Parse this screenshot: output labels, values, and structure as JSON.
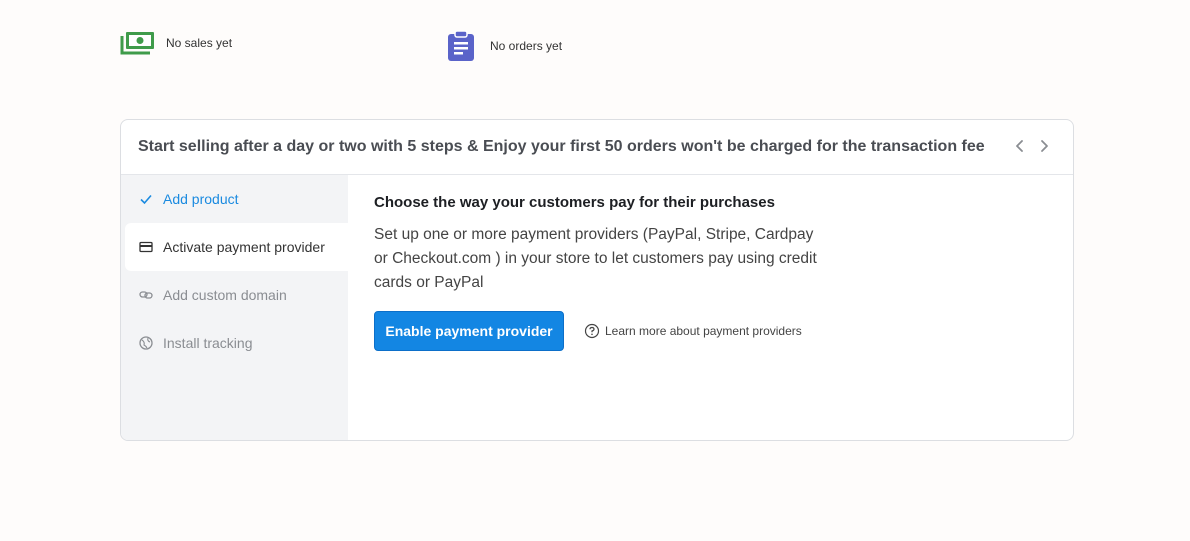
{
  "stats": {
    "sales_label": "No sales yet",
    "orders_label": "No orders yet"
  },
  "banner": {
    "title": "Start selling after a day or two with 5 steps & Enjoy your first 50 orders won't be charged for the transaction fee"
  },
  "steps": [
    {
      "label": "Add product",
      "icon": "check-icon",
      "state": "done"
    },
    {
      "label": "Activate payment provider",
      "icon": "credit-card-icon",
      "state": "active"
    },
    {
      "label": "Add custom domain",
      "icon": "link-icon",
      "state": "pending"
    },
    {
      "label": "Install tracking",
      "icon": "globe-icon",
      "state": "pending"
    }
  ],
  "content": {
    "heading": "Choose the way your customers pay for their purchases",
    "description": "Set up one or more payment providers (PayPal, Stripe, Cardpay or Checkout.com ) in your store to let customers pay using credit cards or PayPal",
    "primary_button": "Enable payment provider",
    "learn_more": "Learn more about payment providers"
  },
  "colors": {
    "accent": "#1386e3",
    "sales_icon": "#3f9b4a",
    "orders_icon": "#5a63c9"
  }
}
